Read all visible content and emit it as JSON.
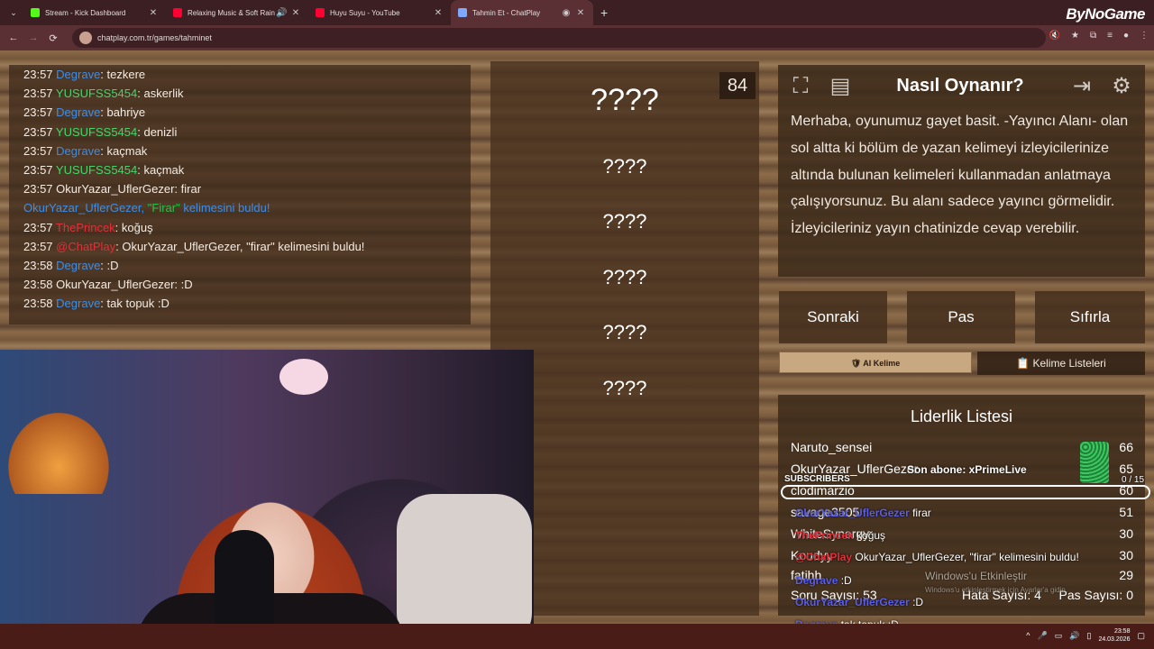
{
  "browser": {
    "tabs": [
      {
        "title": "Stream - Kick Dashboard",
        "icon_color": "#53fc18",
        "active": false
      },
      {
        "title": "Relaxing Music & Soft Rain",
        "icon_color": "#ff0033",
        "active": false
      },
      {
        "title": "Huyu Suyu - YouTube",
        "icon_color": "#ff0033",
        "active": false
      },
      {
        "title": "Tahmin Et - ChatPlay",
        "icon_color": "#7fa8ff",
        "active": true
      }
    ],
    "url": "chatplay.com.tr/games/tahminet",
    "brand": "ByNoGame"
  },
  "chat": [
    {
      "time": "23:57",
      "user": "Degrave",
      "user_color": "blue",
      "msg": ": tezkere"
    },
    {
      "time": "23:57",
      "user": "YUSUFSS5454",
      "user_color": "green",
      "msg": ": askerlik"
    },
    {
      "time": "23:57",
      "user": "Degrave",
      "user_color": "blue",
      "msg": ": bahriye"
    },
    {
      "time": "23:57",
      "user": "YUSUFSS5454",
      "user_color": "green",
      "msg": ": denizli"
    },
    {
      "time": "23:57",
      "user": "Degrave",
      "user_color": "blue",
      "msg": ": kaçmak"
    },
    {
      "time": "23:57",
      "user": "YUSUFSS5454",
      "user_color": "green",
      "msg": ": kaçmak"
    },
    {
      "time": "23:57",
      "user": "OkurYazar_UflerGezer",
      "user_color": "white",
      "msg": ": firar"
    },
    {
      "time": "",
      "user": "OkurYazar_UflerGezer, ",
      "user_color": "blue",
      "msg": "kelimesini buldu!",
      "highlight": "\"Firar\""
    },
    {
      "time": "23:57",
      "user": "ThePrincek",
      "user_color": "red",
      "msg": ": koğuş"
    },
    {
      "time": "23:57",
      "user": "@ChatPlay",
      "user_color": "red",
      "msg": ": OkurYazar_UflerGezer, \"firar\" kelimesini buldu!"
    },
    {
      "time": "23:58",
      "user": "Degrave",
      "user_color": "blue",
      "msg": ": :D"
    },
    {
      "time": "23:58",
      "user": "OkurYazar_UflerGezer",
      "user_color": "white",
      "msg": ": :D"
    },
    {
      "time": "23:58",
      "user": "Degrave",
      "user_color": "blue",
      "msg": ": tak topuk :D"
    }
  ],
  "game": {
    "counter": "84",
    "words": [
      "????",
      "????",
      "????",
      "????",
      "????",
      "????"
    ],
    "how_title": "Nasıl Oynanır?",
    "how_text": "Merhaba, oyunumuz gayet basit. -Yayıncı Alanı- olan sol altta ki bölüm de yazan kelimeyi izleyicilerinize altında bulunan kelimeleri kullanmadan anlatmaya çalışıyorsunuz. Bu alanı sadece yayıncı görmelidir. İzleyicileriniz yayın chatinizde cevap verebilir.",
    "buttons": {
      "next": "Sonraki",
      "pass": "Pas",
      "reset": "Sıfırla"
    },
    "ai_word": "AI Kelime",
    "word_lists": "Kelime Listeleri",
    "leaderboard_title": "Liderlik Listesi",
    "leaderboard": [
      {
        "name": "Naruto_sensei",
        "score": "66"
      },
      {
        "name": "OkurYazar_UflerGezer",
        "score": "65"
      },
      {
        "name": "clodimarzio",
        "score": "60"
      },
      {
        "name": "savage3505",
        "score": "51"
      },
      {
        "name": "WhiteSynergy",
        "score": "30"
      },
      {
        "name": "Koudyy",
        "score": "30"
      },
      {
        "name": "fatihh",
        "score": "29"
      }
    ],
    "questions_label": "Soru Sayısı: 53",
    "errors_label": "Hata Sayısı: 4",
    "pass_label": "Pas Sayısı: 0"
  },
  "overlay": {
    "last_sub": "Son abone: xPrimeLive",
    "subscribers_label": "SUBSCRIBERS",
    "subscribers_count": "0 / 15",
    "chat": [
      {
        "user": "OkurYazar_UflerGezer",
        "msg": "firar"
      },
      {
        "user": "ThePrincek",
        "msg": "koğuş"
      },
      {
        "user": "@ChatPlay",
        "msg": "OkurYazar_UflerGezer, \"firar\" kelimesini buldu!"
      },
      {
        "user": "Degrave",
        "msg": ":D"
      },
      {
        "user": "OkurYazar_UflerGezer",
        "msg": ":D"
      },
      {
        "user": "Degrave",
        "msg": "tak topuk :D"
      }
    ],
    "windows_title": "Windows'u Etkinleştir",
    "windows_sub": "Windows'u etkinleştirmek için Ayarlar'a gidin."
  },
  "taskbar": {
    "time": "23:58",
    "date": "24.03.2026"
  }
}
